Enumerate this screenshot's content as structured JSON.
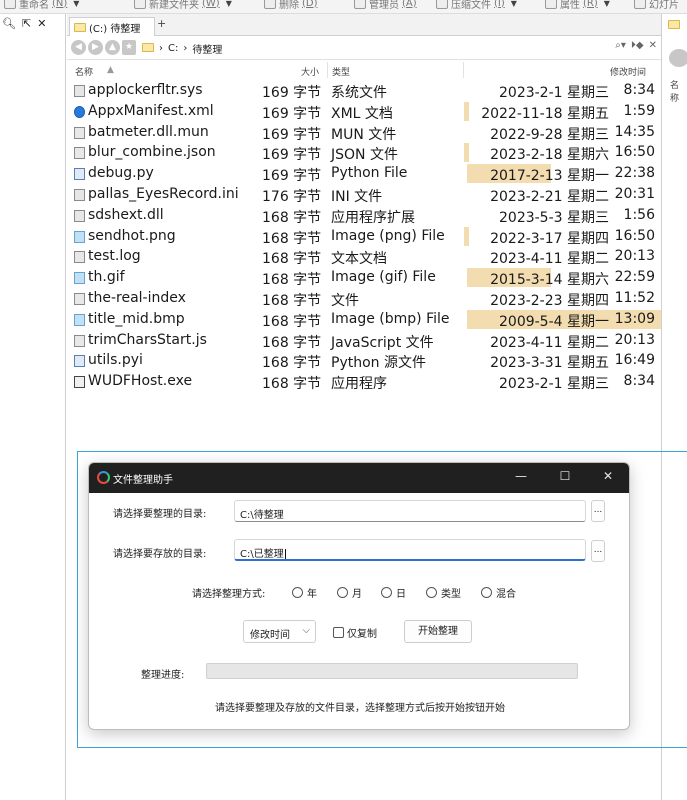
{
  "toolbar": {
    "items": [
      {
        "label": "重命名",
        "key": "(N)"
      },
      {
        "label": "新建文件夹",
        "key": "(W)"
      },
      {
        "label": "删除",
        "key": "(D)"
      },
      {
        "label": "管理员",
        "key": "(A)"
      },
      {
        "label": "压缩文件",
        "key": "(I)"
      },
      {
        "label": "属性",
        "key": "(R)"
      },
      {
        "label": "幻灯片",
        "key": ""
      }
    ]
  },
  "tab": {
    "label": "(C:) 待整理",
    "plus": "+"
  },
  "address": {
    "crumbs": [
      "C:",
      "待整理"
    ],
    "sep": "›"
  },
  "columns": {
    "name": "名称",
    "size": "大小",
    "type": "类型",
    "modified": "修改时间",
    "right_name": "名称"
  },
  "files": [
    {
      "name": "applockerfltr.sys",
      "size": "169 字节",
      "type": "系统文件",
      "date": "2023-2-1 星期三",
      "time": "8:34",
      "icon": "cfg-file-icon"
    },
    {
      "name": "AppxManifest.xml",
      "size": "169 字节",
      "type": "XML 文档",
      "date": "2022-11-18 星期五",
      "time": "1:59",
      "icon": "edge-icon"
    },
    {
      "name": "batmeter.dll.mun",
      "size": "169 字节",
      "type": "MUN 文件",
      "date": "2022-9-28 星期三",
      "time": "14:35",
      "icon": "file-icon"
    },
    {
      "name": "blur_combine.json",
      "size": "169 字节",
      "type": "JSON 文件",
      "date": "2023-2-18 星期六",
      "time": "16:50",
      "icon": "json-file-icon"
    },
    {
      "name": "debug.py",
      "size": "169 字节",
      "type": "Python File",
      "date": "2017-2-13 星期一",
      "time": "22:38",
      "icon": "python-file-icon"
    },
    {
      "name": "pallas_EyesRecord.ini",
      "size": "176 字节",
      "type": "INI 文件",
      "date": "2023-2-21 星期二",
      "time": "20:31",
      "icon": "ini-file-icon"
    },
    {
      "name": "sdshext.dll",
      "size": "168 字节",
      "type": "应用程序扩展",
      "date": "2023-5-3 星期三",
      "time": "1:56",
      "icon": "dll-file-icon"
    },
    {
      "name": "sendhot.png",
      "size": "168 字节",
      "type": "Image (png) File",
      "date": "2022-3-17 星期四",
      "time": "16:50",
      "icon": "image-file-icon"
    },
    {
      "name": "test.log",
      "size": "168 字节",
      "type": "文本文档",
      "date": "2023-4-11 星期二",
      "time": "20:13",
      "icon": "text-file-icon"
    },
    {
      "name": "th.gif",
      "size": "168 字节",
      "type": "Image (gif) File",
      "date": "2015-3-14 星期六",
      "time": "22:59",
      "icon": "image-file-icon"
    },
    {
      "name": "the-real-index",
      "size": "168 字节",
      "type": "文件",
      "date": "2023-2-23 星期四",
      "time": "11:52",
      "icon": "file-icon"
    },
    {
      "name": "title_mid.bmp",
      "size": "168 字节",
      "type": "Image (bmp) File",
      "date": "2009-5-4 星期一",
      "time": "13:09",
      "icon": "image-file-icon"
    },
    {
      "name": "trimCharsStart.js",
      "size": "168 字节",
      "type": "JavaScript 文件",
      "date": "2023-4-11 星期二",
      "time": "20:13",
      "icon": "js-file-icon"
    },
    {
      "name": "utils.pyi",
      "size": "168 字节",
      "type": "Python 源文件",
      "date": "2023-3-31 星期五",
      "time": "16:49",
      "icon": "python-file-icon"
    },
    {
      "name": "WUDFHost.exe",
      "size": "168 字节",
      "type": "应用程序",
      "date": "2023-2-1 星期三",
      "time": "8:34",
      "icon": "exe-file-icon"
    }
  ],
  "dialog": {
    "title": "文件整理助手",
    "src_label": "请选择要整理的目录:",
    "src_value": "C:\\待整理",
    "dst_label": "请选择要存放的目录:",
    "dst_value": "C:\\已整理",
    "browse": "...",
    "mode_label": "请选择整理方式:",
    "modes": [
      "年",
      "月",
      "日",
      "类型",
      "混合"
    ],
    "combo_value": "修改时间",
    "copy_only": "仅复制",
    "start_button": "开始整理",
    "progress_label": "整理进度:",
    "progress": 0,
    "status": "请选择要整理及存放的文件目录，选择整理方式后按开始按钮开始"
  }
}
